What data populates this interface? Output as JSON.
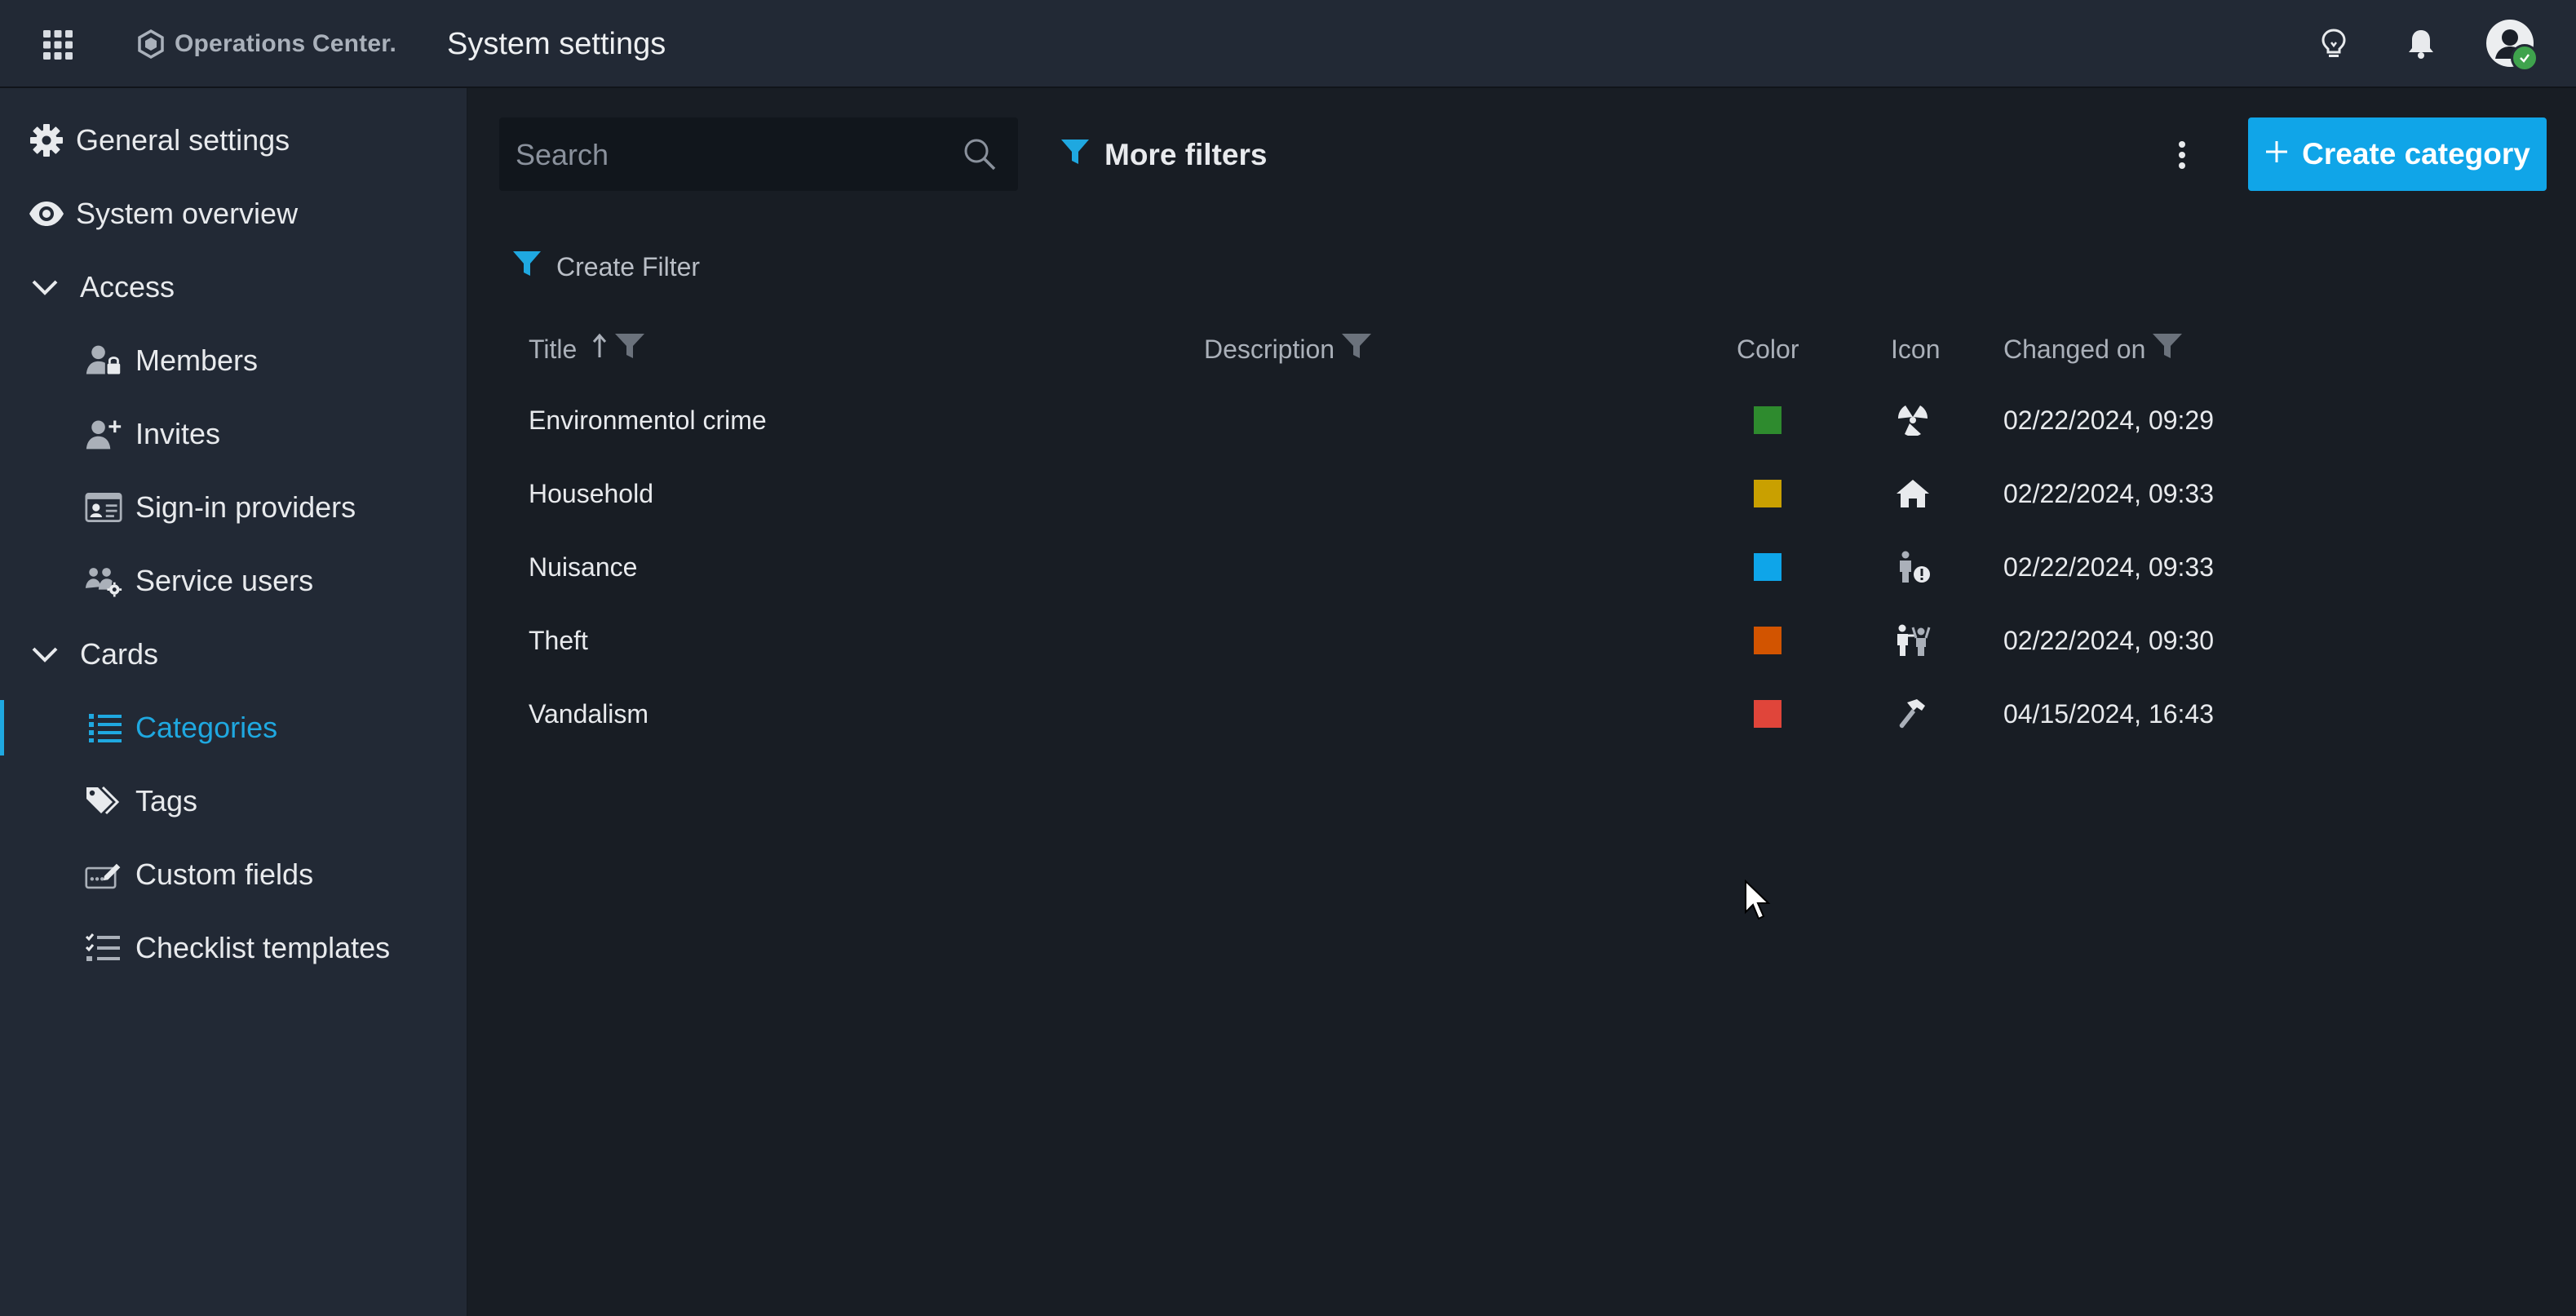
{
  "header": {
    "brand": "Operations Center.",
    "title": "System settings"
  },
  "sidebar": {
    "items": [
      {
        "label": "General settings",
        "icon": "gear-icon"
      },
      {
        "label": "System overview",
        "icon": "eye-icon"
      },
      {
        "label": "Access",
        "icon": "chevron-down-icon"
      },
      {
        "label": "Members",
        "icon": "user-lock-icon"
      },
      {
        "label": "Invites",
        "icon": "user-plus-icon"
      },
      {
        "label": "Sign-in providers",
        "icon": "id-card-icon"
      },
      {
        "label": "Service users",
        "icon": "users-gear-icon"
      },
      {
        "label": "Cards",
        "icon": "chevron-down-icon"
      },
      {
        "label": "Categories",
        "icon": "list-icon",
        "active": true
      },
      {
        "label": "Tags",
        "icon": "tags-icon"
      },
      {
        "label": "Custom fields",
        "icon": "field-edit-icon"
      },
      {
        "label": "Checklist templates",
        "icon": "checklist-icon"
      }
    ]
  },
  "toolbar": {
    "search_placeholder": "Search",
    "more_filters": "More filters",
    "create_label": "Create category",
    "create_filter": "Create Filter"
  },
  "table": {
    "columns": {
      "title": "Title",
      "description": "Description",
      "color": "Color",
      "icon": "Icon",
      "changed_on": "Changed on"
    },
    "rows": [
      {
        "title": "Environmentol crime",
        "description": "",
        "color": "#2e8b2e",
        "icon": "radiation-icon",
        "changed_on": "02/22/2024, 09:29"
      },
      {
        "title": "Household",
        "description": "",
        "color": "#c9a000",
        "icon": "house-icon",
        "changed_on": "02/22/2024, 09:33"
      },
      {
        "title": "Nuisance",
        "description": "",
        "color": "#0ea5e9",
        "icon": "person-alert-icon",
        "changed_on": "02/22/2024, 09:33"
      },
      {
        "title": "Theft",
        "description": "",
        "color": "#d25400",
        "icon": "robbery-icon",
        "changed_on": "02/22/2024, 09:30"
      },
      {
        "title": "Vandalism",
        "description": "",
        "color": "#e0453a",
        "icon": "hammer-icon",
        "changed_on": "04/15/2024, 16:43"
      }
    ]
  },
  "colors": {
    "accent": "#10a5e8",
    "background": "#181d24",
    "sidebar": "#222935"
  }
}
